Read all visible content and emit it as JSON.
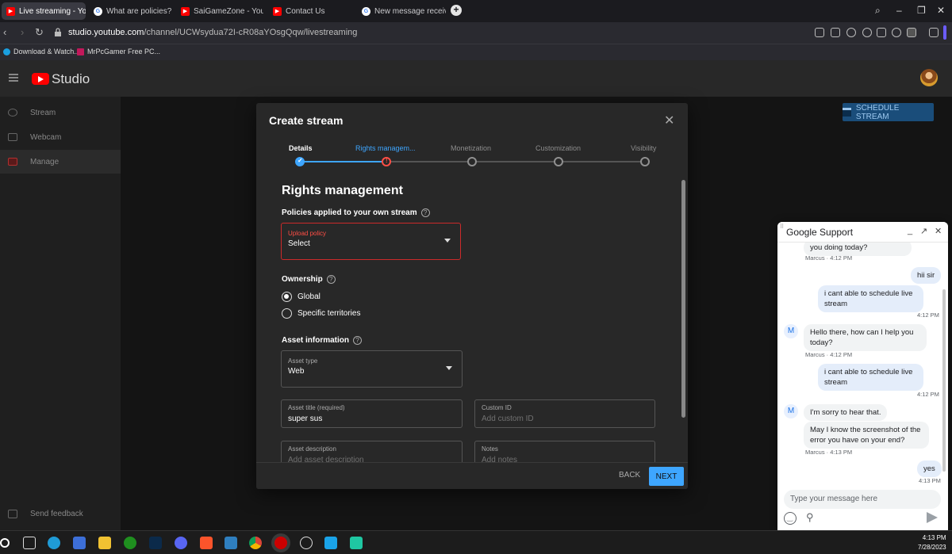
{
  "browser": {
    "tabs": [
      {
        "label": "Live streaming - YouTube",
        "type": "yt",
        "active": true
      },
      {
        "label": "What are policies? - YouTube",
        "type": "g",
        "active": false
      },
      {
        "label": "SaiGameZone - YouTube",
        "type": "yt",
        "active": false
      },
      {
        "label": "Contact Us",
        "type": "yt",
        "active": false
      },
      {
        "label": "New message received...",
        "type": "g",
        "active": false
      }
    ],
    "url_host": "studio.youtube.com",
    "url_path": "/channel/UCWsydua72I-cR08aYOsgQqw/livestreaming",
    "bookmarks": [
      "Download & Watch...",
      "MrPcGamer Free PC..."
    ]
  },
  "studio": {
    "logo_text": "Studio",
    "sidebar": [
      {
        "label": "Stream",
        "active": false
      },
      {
        "label": "Webcam",
        "active": false
      },
      {
        "label": "Manage",
        "active": true
      }
    ],
    "feedback_label": "Send feedback",
    "schedule_label": "SCHEDULE STREAM"
  },
  "modal": {
    "title": "Create stream",
    "steps": [
      "Details",
      "Rights managem...",
      "Monetization",
      "Customization",
      "Visibility"
    ],
    "section_title": "Rights management",
    "policies_label": "Policies applied to your own stream",
    "upload_policy": {
      "label": "Upload policy",
      "value": "Select"
    },
    "ownership_label": "Ownership",
    "ownership_options": [
      {
        "label": "Global",
        "selected": true
      },
      {
        "label": "Specific territories",
        "selected": false
      }
    ],
    "asset_info_label": "Asset information",
    "asset_type": {
      "label": "Asset type",
      "value": "Web"
    },
    "asset_title": {
      "label": "Asset title (required)",
      "value": "super sus"
    },
    "custom_id": {
      "label": "Custom ID",
      "placeholder": "Add custom ID"
    },
    "asset_description": {
      "label": "Asset description",
      "placeholder": "Add asset description"
    },
    "notes": {
      "label": "Notes",
      "placeholder": "Add notes"
    },
    "back_label": "BACK",
    "next_label": "NEXT"
  },
  "chat": {
    "title": "Google Support",
    "messages": [
      {
        "from": "agent",
        "text": "you doing today?",
        "meta": "Marcus · 4:12 PM"
      },
      {
        "from": "user",
        "text": "hii sir",
        "meta": ""
      },
      {
        "from": "user",
        "text": "i cant able to schedule live stream",
        "meta": "4:12 PM"
      },
      {
        "from": "agent",
        "text": "Hello there, how can I help you today?",
        "meta": "Marcus · 4:12 PM"
      },
      {
        "from": "user",
        "text": "i cant able to schedule live stream",
        "meta": "4:12 PM"
      },
      {
        "from": "agent",
        "text": "I'm sorry to hear that.",
        "meta": ""
      },
      {
        "from": "agent",
        "text": "May I know the screenshot of the error you have on your end?",
        "meta": "Marcus · 4:13 PM"
      },
      {
        "from": "user",
        "text": "yes",
        "meta": "4:13 PM"
      }
    ],
    "avatar_letter": "M",
    "input_placeholder": "Type your message here"
  },
  "taskbar": {
    "time": "4:13 PM",
    "date": "7/28/2023"
  },
  "colors": {
    "accent": "#3ea6ff",
    "error": "#ff4e45",
    "youtube_red": "#ff0000"
  }
}
